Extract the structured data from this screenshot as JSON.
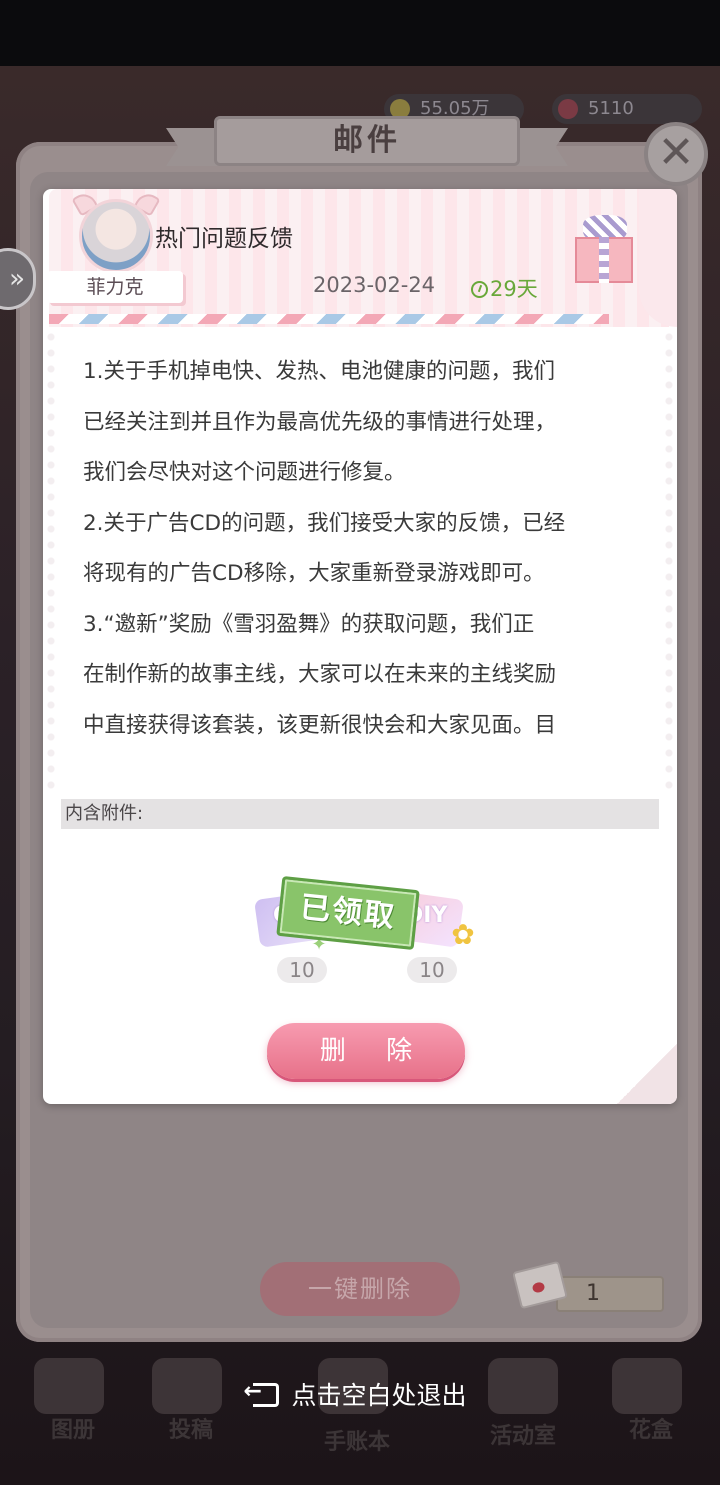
{
  "topbar": {
    "currency_a": "55.05万",
    "currency_b": "5110"
  },
  "panel": {
    "title": "邮件",
    "close_icon": "close-icon"
  },
  "mail": {
    "sender": "菲力克",
    "subject": "热门问题反馈",
    "date": "2023-02-24",
    "expires_in": "29天",
    "body_lines": [
      "1.关于手机掉电快、发热、电池健康的问题，我们",
      "已经关注到并且作为最高优先级的事情进行处理，",
      "我们会尽快对这个问题进行修复。",
      "2.关于广告CD的问题，我们接受大家的反馈，已经",
      "将现有的广告CD移除，大家重新登录游戏即可。",
      "3.“邀新”奖励《雪羽盈舞》的获取问题，我们正",
      "在制作新的故事主线，大家可以在未来的主线奖励",
      "中直接获得该套装，该更新很快会和大家见面。目"
    ],
    "attachments_label": "内含附件:",
    "attachments": [
      {
        "label": "C",
        "qty": "10"
      },
      {
        "label": "DIY",
        "qty": "10"
      }
    ],
    "claimed_stamp": "已领取",
    "delete_label": "删 除"
  },
  "footer": {
    "bulk_delete_label": "一键删除",
    "mail_count": "1",
    "exit_hint": "点击空白处退出"
  },
  "bottom_nav": [
    "图册",
    "投稿",
    "手账本",
    "活动室",
    "花盒"
  ],
  "colors": {
    "accent_pink": "#e77189",
    "claimed_green": "#89c46a",
    "expire_green": "#69a83a"
  }
}
